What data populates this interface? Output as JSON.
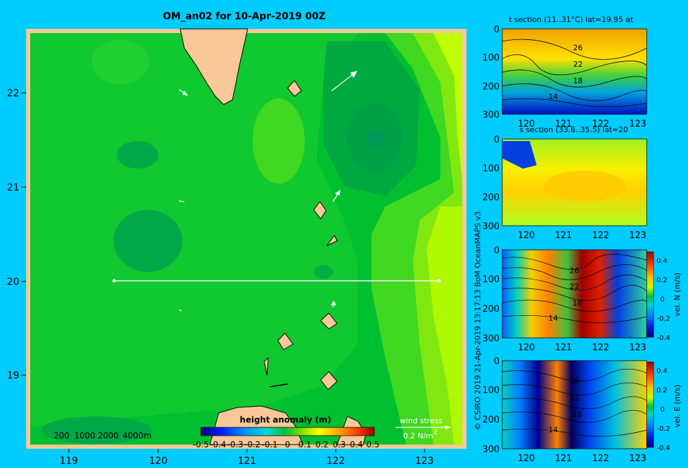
{
  "title": "OM_an02 for 10-Apr-2019 00Z",
  "map": {
    "lat_ticks": [
      "22",
      "21",
      "20",
      "19"
    ],
    "lon_ticks": [
      "119",
      "120",
      "121",
      "122",
      "123"
    ],
    "depth_legend": [
      "200",
      "1000",
      "2000",
      "4000m"
    ],
    "colorbar_title": "height anomaly (m)",
    "colorbar_ticks": [
      "-0.5",
      "-0.4",
      "-0.3",
      "-0.2",
      "-0.1",
      "0",
      "0.1",
      "0.2",
      "0.3",
      "0.4",
      "0.5"
    ],
    "wind_stress_label": "wind stress",
    "wind_stress_scale": "0.2 N/m",
    "wind_stress_superscript": "2"
  },
  "panels": {
    "t_section_title": "t section (11..31°C) lat=19.95 at",
    "s_section_title": "s section (33.6..35.5) lat=20",
    "depth_ticks": [
      "0",
      "100",
      "200",
      "300"
    ],
    "lon_ticks": [
      "120",
      "121",
      "122",
      "123"
    ],
    "contour_labels": [
      "26",
      "22",
      "18",
      "14"
    ],
    "vel_colorbar_ticks": [
      "0.4",
      "0.2",
      "0",
      "-0.2",
      "-0.4"
    ],
    "vel_n_label": "vel. N (m/s)",
    "vel_e_label": "vel. E (m/s)"
  },
  "credit": "© CSIRO 2019  21-Apr-2019 13:17:13 BoM OceanMAPS v3",
  "colors": {
    "background": "#00ccff",
    "land": "#f8c898",
    "sea_dark": "#00a840",
    "sea_mid": "#00c030",
    "sea_light": "#40d820",
    "sea_yellow": "#c0ff00"
  }
}
